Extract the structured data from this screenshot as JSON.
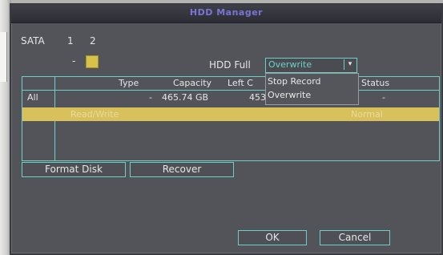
{
  "dialog": {
    "title": "HDD Manager"
  },
  "sata": {
    "label": "SATA",
    "ports": [
      "1",
      "2"
    ],
    "selected_marker": "-"
  },
  "hdd_full": {
    "label": "HDD Full",
    "selected": "Overwrite",
    "options": [
      "Stop Record",
      "Overwrite"
    ]
  },
  "table": {
    "headers": [
      "Type",
      "Capacity",
      "Left C",
      "Status"
    ],
    "rows": [
      {
        "name": "All",
        "type": "-",
        "capacity": "465.74 GB",
        "left": "453",
        "status": "-"
      },
      {
        "name": "",
        "type": "Read/Write",
        "capacity": "",
        "left": "",
        "status": "Normal"
      }
    ]
  },
  "buttons": {
    "format": "Format Disk",
    "recover": "Recover",
    "ok": "OK",
    "cancel": "Cancel"
  },
  "colors": {
    "accent": "#6cd0c8",
    "selection": "#d8c05a",
    "title": "#7a74d6"
  }
}
